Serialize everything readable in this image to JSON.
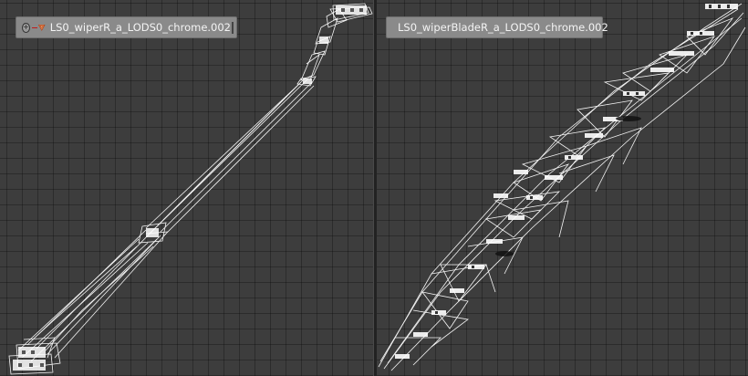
{
  "left_viewport": {
    "object_label": "LS0_wiperR_a_LODS0_chrome.002",
    "expand_icon": "plus-circle-icon",
    "object_icon": "mesh-triangle-icon"
  },
  "right_viewport": {
    "object_label": "LS0_wiperBladeR_a_LODS0_chrome.002",
    "object_icon": "mesh-triangle-icon"
  },
  "colors": {
    "background": "#3d3d3d",
    "grid": "#2f2f2f",
    "label_bg": "#8a8a8a",
    "wire": "#ffffff",
    "icon_accent": "#e86a2c"
  }
}
